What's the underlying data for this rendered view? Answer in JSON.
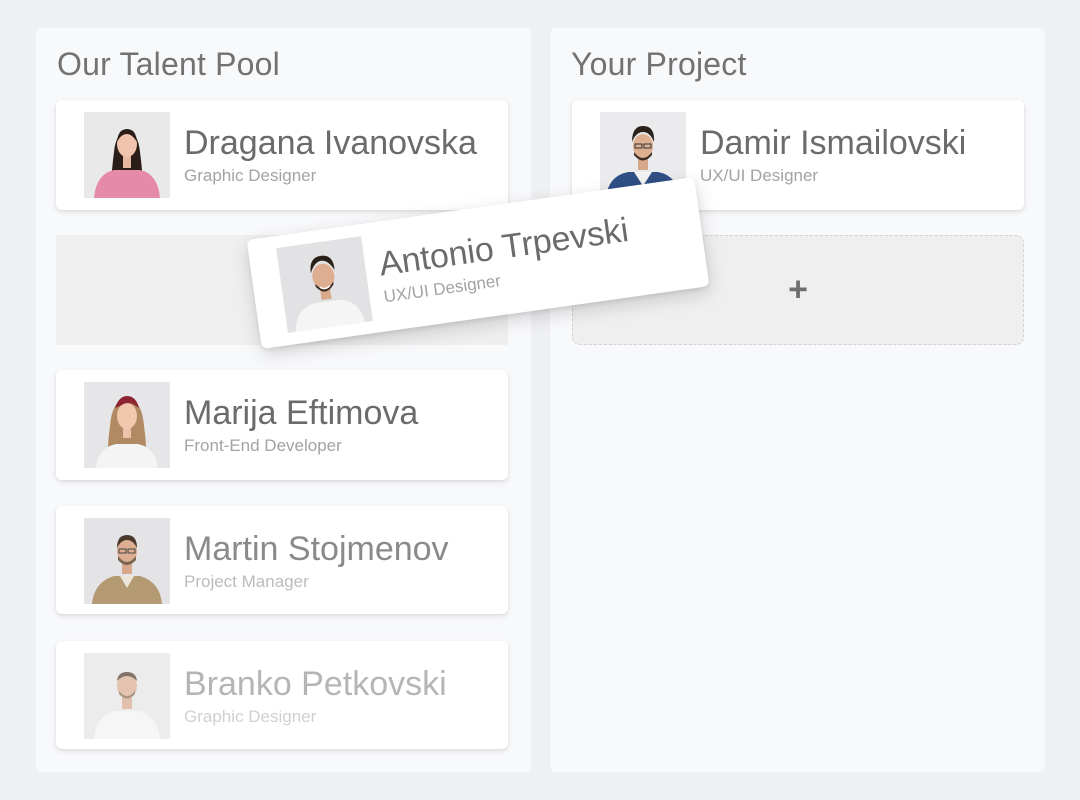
{
  "talent_pool": {
    "title": "Our Talent Pool",
    "members": [
      {
        "name": "Dragana Ivanovska",
        "role": "Graphic Designer"
      },
      {
        "name": "Marija Eftimova",
        "role": "Front-End Developer"
      },
      {
        "name": "Martin Stojmenov",
        "role": "Project Manager"
      },
      {
        "name": "Branko Petkovski",
        "role": "Graphic Designer"
      }
    ]
  },
  "project": {
    "title": "Your Project",
    "members": [
      {
        "name": "Damir Ismailovski",
        "role": "UX/UI Designer"
      }
    ],
    "add_symbol": "+"
  },
  "dragging": {
    "name": "Antonio Trpevski",
    "role": "UX/UI Designer"
  },
  "colors": {
    "background": "#eff0f2",
    "panel": "#f8f9fb",
    "card": "#ffffff",
    "name_text": "#6b6b6b",
    "role_text": "#a3a3a3"
  },
  "icons": {
    "add": "plus-icon"
  }
}
